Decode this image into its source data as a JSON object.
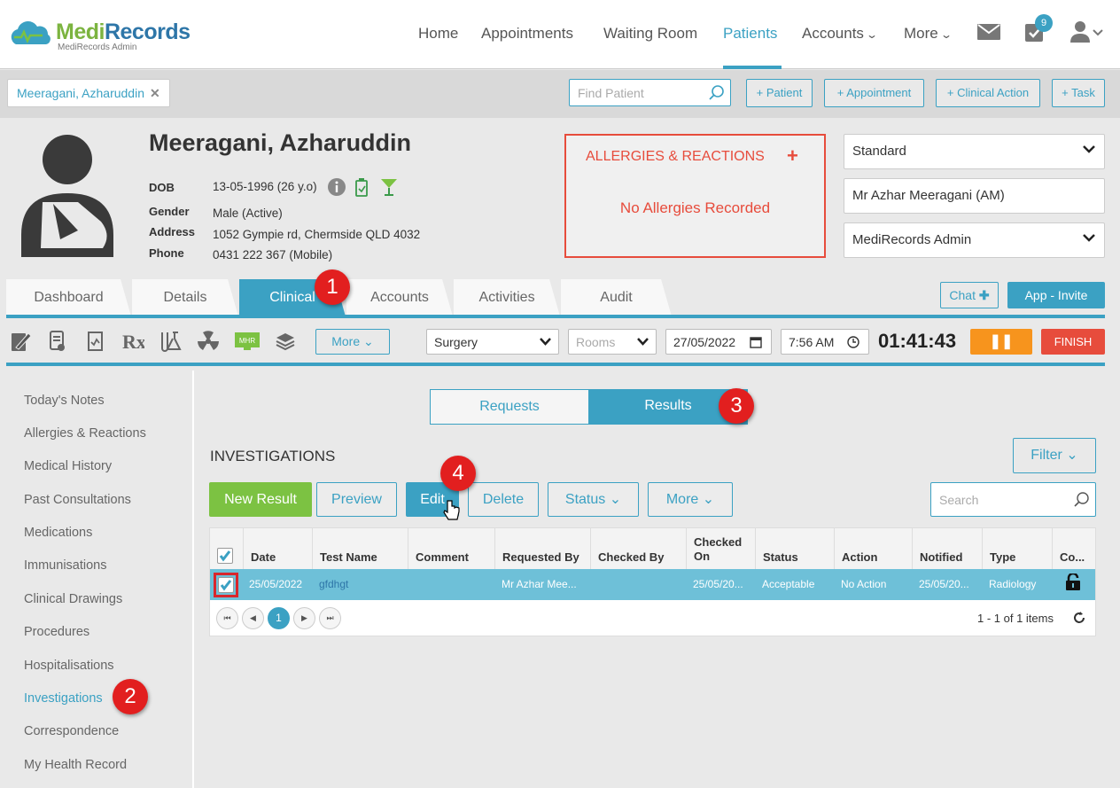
{
  "app": {
    "name": "MediRecords",
    "subtitle": "MediRecords Admin"
  },
  "nav": {
    "home": "Home",
    "appointments": "Appointments",
    "waiting_room": "Waiting Room",
    "patients": "Patients",
    "accounts": "Accounts",
    "more": "More",
    "task_badge": "9"
  },
  "toolbar": {
    "patient_tab": "Meeragani, Azharuddin",
    "find_placeholder": "Find Patient",
    "add_patient": "+ Patient",
    "add_appointment": "+ Appointment",
    "add_clinical_action": "+ Clinical Action",
    "add_task": "+ Task"
  },
  "patient": {
    "name": "Meeragani, Azharuddin",
    "dob_label": "DOB",
    "dob": "13-05-1996 (26 y.o)",
    "gender_label": "Gender",
    "gender": "Male (Active)",
    "address_label": "Address",
    "address": "1052 Gympie rd, Chermside QLD 4032",
    "phone_label": "Phone",
    "phone": "0431 222 367 (Mobile)"
  },
  "allergies": {
    "title": "ALLERGIES & REACTIONS",
    "add": "+",
    "empty": "No Allergies Recorded"
  },
  "selects": {
    "billing": "Standard",
    "practitioner": "Mr Azhar Meeragani (AM)",
    "practice": "MediRecords Admin"
  },
  "tabs": [
    "Dashboard",
    "Details",
    "Clinical",
    "Accounts",
    "Activities",
    "Audit"
  ],
  "chat": "Chat",
  "app_invite": "App - Invite",
  "clinical_bar": {
    "more": "More",
    "location": "Surgery",
    "rooms": "Rooms",
    "date": "27/05/2022",
    "time": "7:56 AM",
    "timer": "01:41:43",
    "finish": "FINISH",
    "mhr": "MHR"
  },
  "sidebar": [
    "Today's Notes",
    "Allergies & Reactions",
    "Medical History",
    "Past Consultations",
    "Medications",
    "Immunisations",
    "Clinical Drawings",
    "Procedures",
    "Hospitalisations",
    "Investigations",
    "Correspondence",
    "My Health Record"
  ],
  "segment": {
    "requests": "Requests",
    "results": "Results"
  },
  "investigations": {
    "title": "INVESTIGATIONS",
    "filter": "Filter",
    "new_result": "New Result",
    "preview": "Preview",
    "edit": "Edit",
    "delete": "Delete",
    "status": "Status",
    "more": "More",
    "search_placeholder": "Search",
    "columns": [
      "Date",
      "Test Name",
      "Comment",
      "Requested By",
      "Checked By",
      "Checked On",
      "Status",
      "Action",
      "Notified",
      "Type",
      "Co..."
    ],
    "row": {
      "date": "25/05/2022",
      "test": "gfdhgt",
      "comment": "",
      "requested_by": "Mr Azhar Mee...",
      "checked_by": "",
      "checked_on": "25/05/20...",
      "status": "Acceptable",
      "action": "No Action",
      "notified": "25/05/20...",
      "type": "Radiology"
    },
    "page": "1",
    "items": "1 - 1 of 1 items"
  },
  "callouts": [
    "1",
    "2",
    "3",
    "4"
  ]
}
